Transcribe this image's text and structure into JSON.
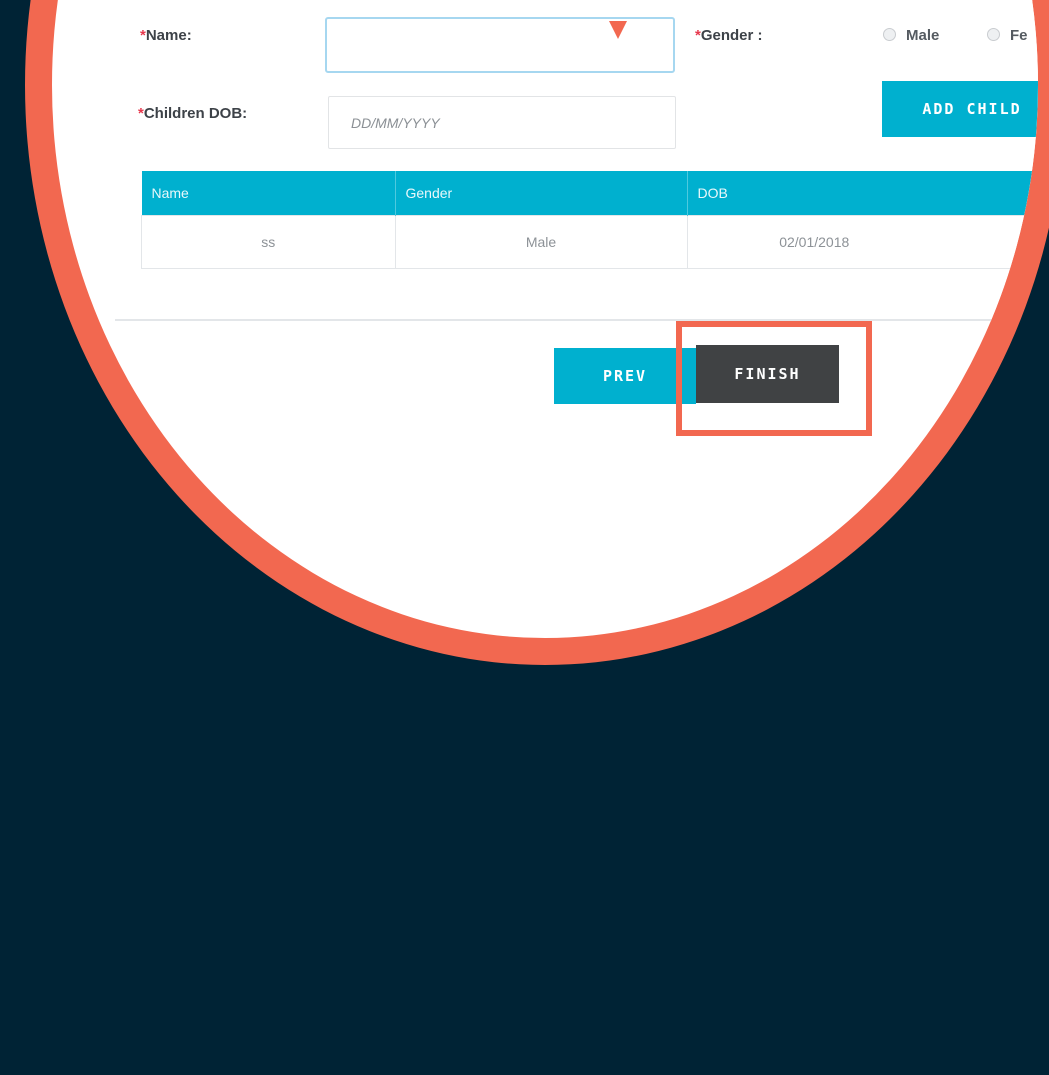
{
  "form": {
    "name_label_req": "*",
    "name_label": "Name:",
    "gender_label_req": "*",
    "gender_label": "Gender :",
    "gender_options": [
      "Male",
      "Fe"
    ],
    "dob_label_req": "*",
    "dob_label": "Children DOB:",
    "dob_placeholder": "DD/MM/YYYY",
    "add_child_label": "ADD CHILD"
  },
  "table": {
    "headers": [
      "Name",
      "Gender",
      "DOB"
    ],
    "rows": [
      [
        "ss",
        "Male",
        "02/01/2018"
      ]
    ]
  },
  "nav": {
    "prev_label": "PREV",
    "finish_label": "FINISH"
  },
  "colors": {
    "accent": "#00b0cf",
    "highlight": "#f26850",
    "background": "#002335",
    "finish_button": "#404244"
  }
}
